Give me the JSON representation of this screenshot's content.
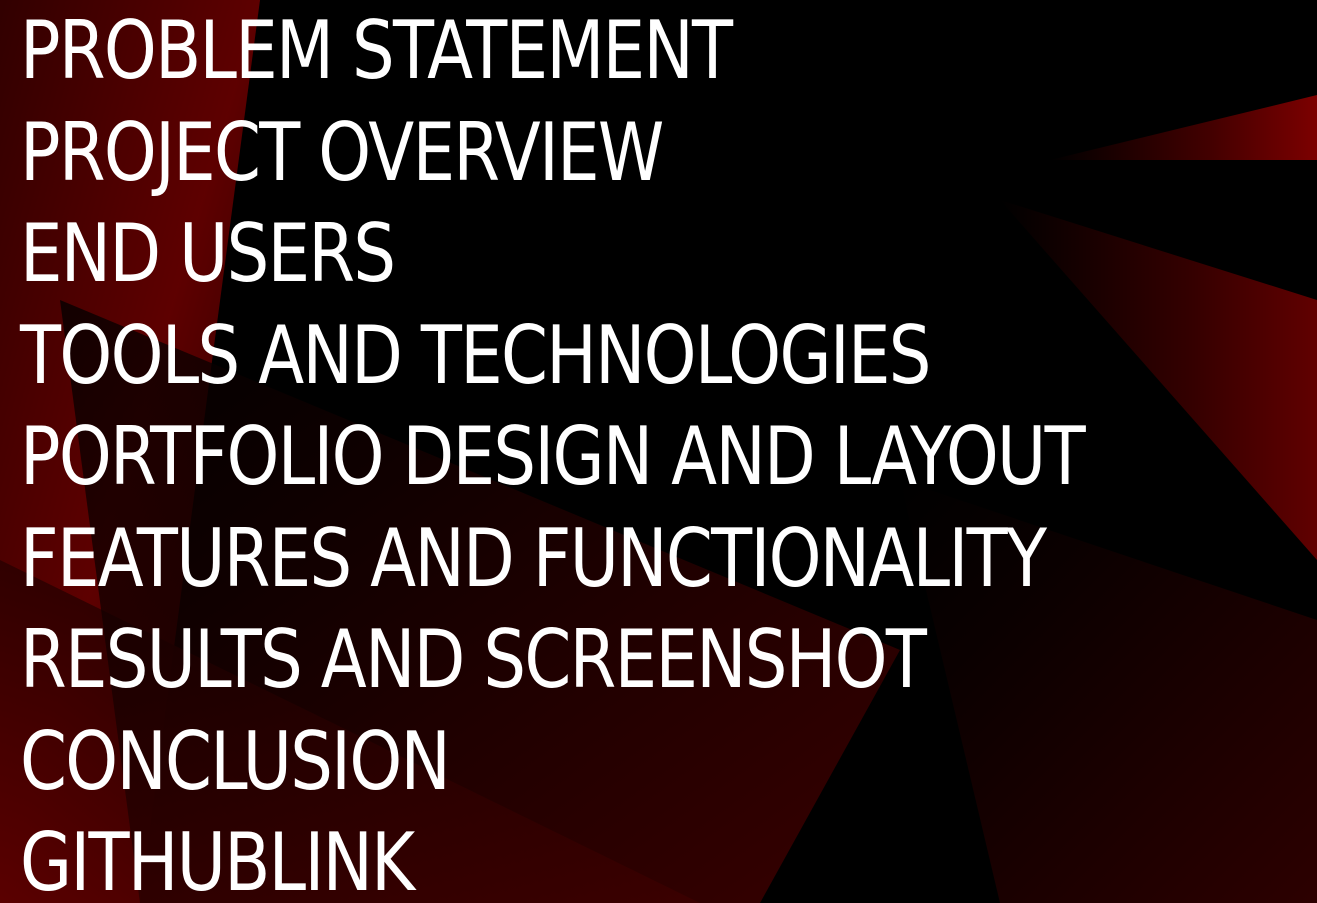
{
  "agenda": {
    "items": [
      "PROBLEM STATEMENT",
      "PROJECT OVERVIEW",
      "END USERS",
      "TOOLS AND TECHNOLOGIES",
      "PORTFOLIO DESIGN AND LAYOUT",
      "FEATURES AND FUNCTIONALITY",
      "RESULTS AND SCREENSHOT",
      "CONCLUSION",
      "GITHUBLINK"
    ]
  },
  "colors": {
    "background": "#000000",
    "accent_red": "#7a0000",
    "text": "#ffffff"
  }
}
